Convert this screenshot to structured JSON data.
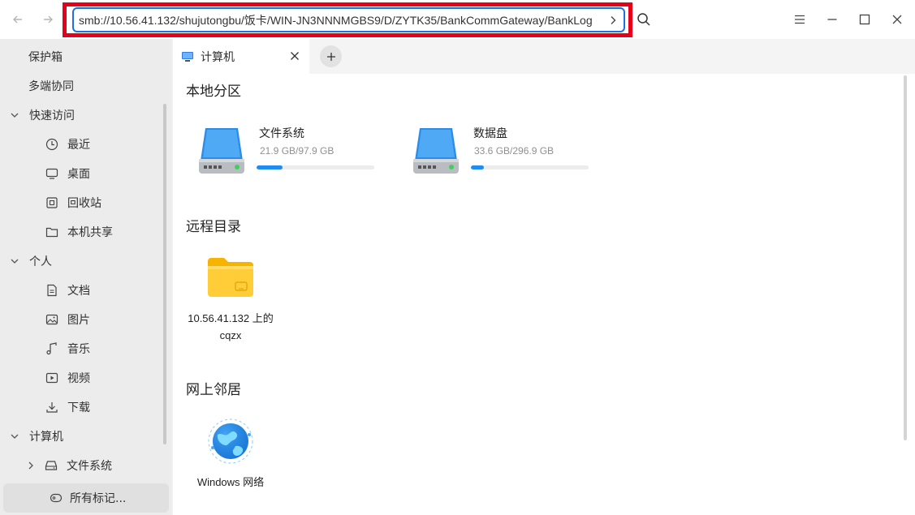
{
  "titlebar": {
    "address": "smb://10.56.41.132/shujutongbu/饭卡/WIN-JN3NNNMGBS9/D/ZYTK35/BankCommGateway/BankLog"
  },
  "sidebar": {
    "items": [
      {
        "label": "保护箱",
        "icon": "vault-icon"
      },
      {
        "label": "多端协同",
        "icon": "sync-icon"
      },
      {
        "label": "快速访问",
        "icon": "chevron-down-icon"
      },
      {
        "label": "最近",
        "icon": "clock-icon"
      },
      {
        "label": "桌面",
        "icon": "desktop-icon"
      },
      {
        "label": "回收站",
        "icon": "trash-icon"
      },
      {
        "label": "本机共享",
        "icon": "folder-icon"
      },
      {
        "label": "个人",
        "icon": "chevron-down-icon"
      },
      {
        "label": "文档",
        "icon": "document-icon"
      },
      {
        "label": "图片",
        "icon": "picture-icon"
      },
      {
        "label": "音乐",
        "icon": "music-icon"
      },
      {
        "label": "视频",
        "icon": "video-icon"
      },
      {
        "label": "下载",
        "icon": "download-icon"
      },
      {
        "label": "计算机",
        "icon": "chevron-down-icon"
      },
      {
        "label": "文件系统",
        "icon": "drive-icon"
      }
    ],
    "bottom_label": "所有标记..."
  },
  "tabs": [
    {
      "label": "计算机"
    }
  ],
  "sections": {
    "local": "本地分区",
    "remote": "远程目录",
    "network": "网上邻居"
  },
  "drives": [
    {
      "name": "文件系统",
      "size": "21.9 GB/97.9 GB",
      "used_fraction": 0.224
    },
    {
      "name": "数据盘",
      "size": "33.6 GB/296.9 GB",
      "used_fraction": 0.113
    }
  ],
  "remote_items": [
    {
      "label": "10.56.41.132 上的 cqzx",
      "icon": "network-folder-icon"
    }
  ],
  "network_items": [
    {
      "label": "Windows 网络",
      "icon": "globe-icon"
    }
  ],
  "colors": {
    "accent": "#1f6fe6",
    "highlight_box": "#e6001a",
    "drive_bar": "#1f8cf0"
  }
}
